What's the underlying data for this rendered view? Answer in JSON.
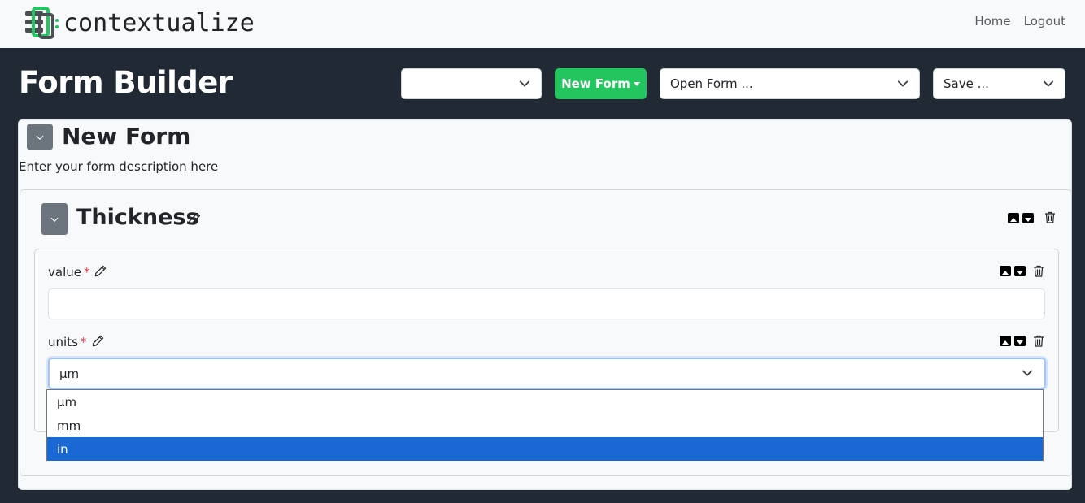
{
  "navbar": {
    "brand": "contextualize",
    "links": [
      "Home",
      "Logout"
    ]
  },
  "header": {
    "title": "Form Builder",
    "blank_select": "",
    "new_form_button": "New Form",
    "open_form_select": "Open Form ...",
    "save_select": "Save ..."
  },
  "form": {
    "title": "New Form",
    "description": "Enter your form description here",
    "section": {
      "title": "Thickness",
      "fields": [
        {
          "label": "value",
          "required_mark": "*",
          "value": ""
        },
        {
          "label": "units",
          "required_mark": "*",
          "value": "μm"
        }
      ]
    }
  },
  "dropdown": {
    "options": [
      "μm",
      "mm",
      "in"
    ],
    "highlighted": "in"
  },
  "colors": {
    "dark_bg": "#212934",
    "accent_green": "#22c55e",
    "highlight_blue": "#1a68d3",
    "required_red": "#dc3545"
  }
}
